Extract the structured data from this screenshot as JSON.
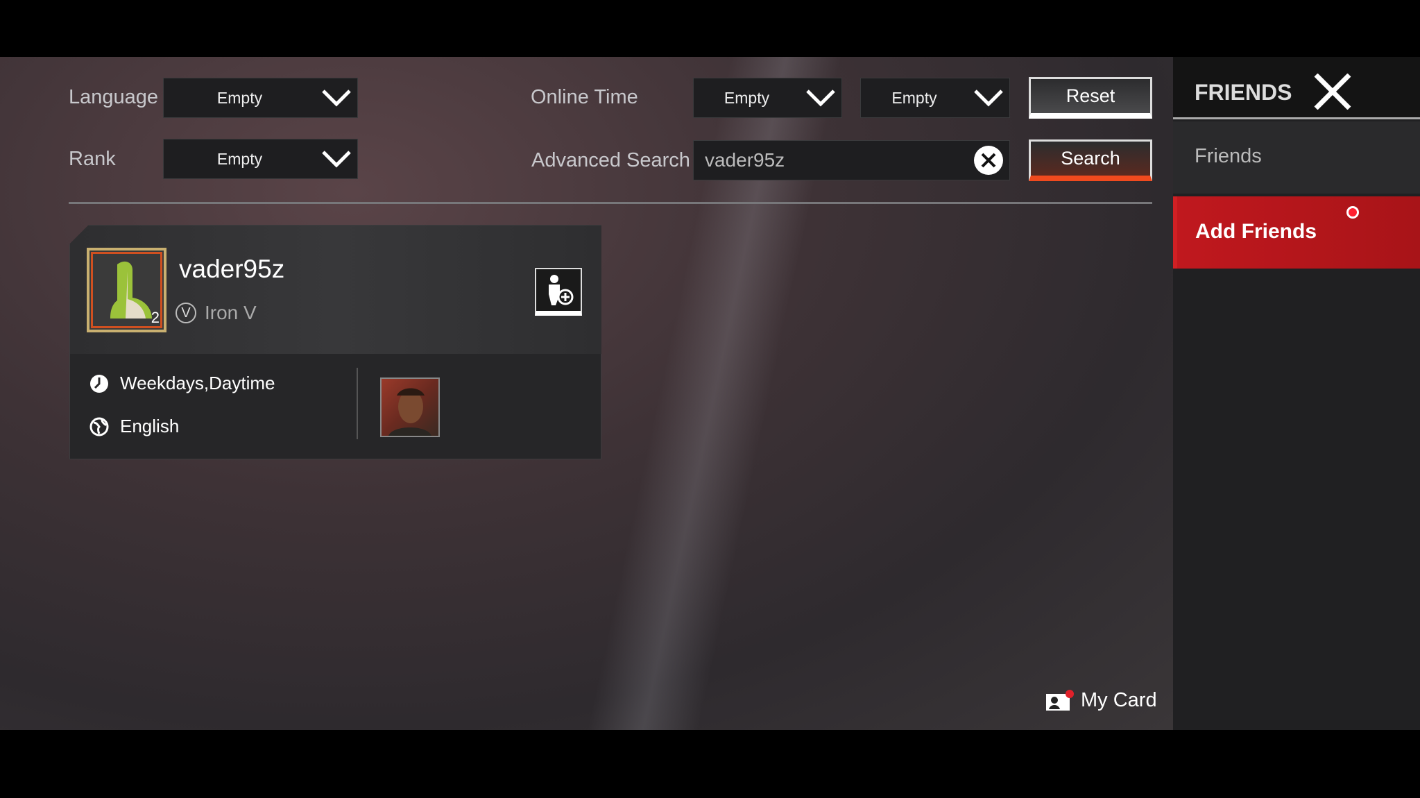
{
  "filters": {
    "language_label": "Language",
    "language_value": "Empty",
    "rank_label": "Rank",
    "rank_value": "Empty",
    "online_time_label": "Online Time",
    "online_time_from": "Empty",
    "online_time_to": "Empty",
    "advanced_search_label": "Advanced Search",
    "advanced_search_value": "vader95z",
    "reset_label": "Reset",
    "search_label": "Search"
  },
  "result": {
    "name": "vader95z",
    "rank": "Iron V",
    "rank_badge": "V",
    "level": "2",
    "online_time": "Weekdays,Daytime",
    "language": "English"
  },
  "my_card_label": "My Card",
  "sidebar": {
    "title": "FRIENDS",
    "items": [
      {
        "label": "Friends"
      },
      {
        "label": "Add Friends"
      }
    ]
  },
  "colors": {
    "accent_red": "#b0161b",
    "search_underline": "#f04a1e"
  }
}
